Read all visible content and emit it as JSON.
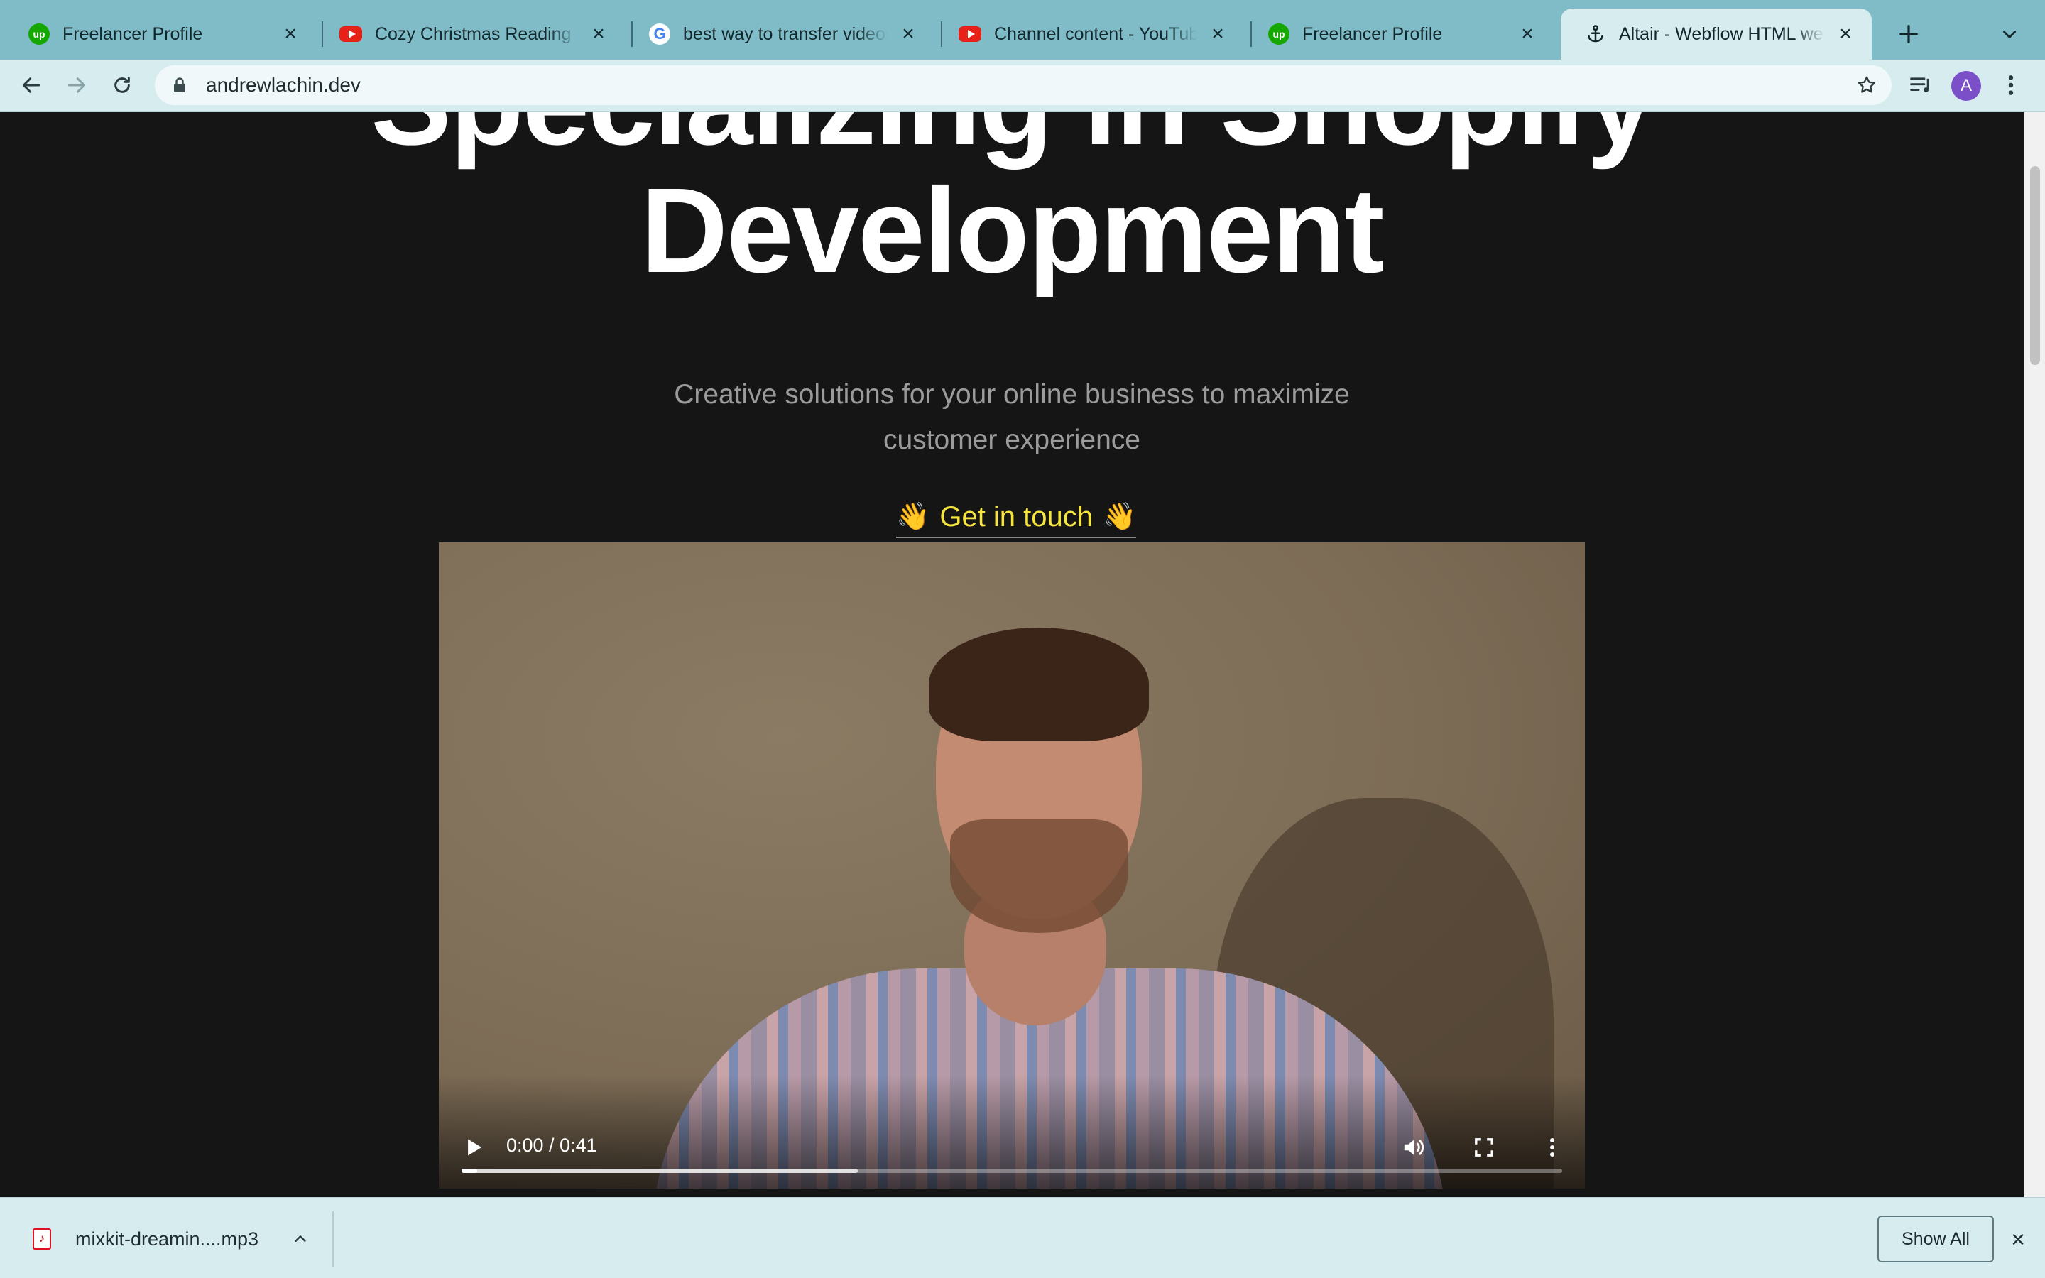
{
  "tabs": [
    {
      "title": "Freelancer Profile",
      "icon": "upwork-icon"
    },
    {
      "title": "Cozy Christmas Reading Nook",
      "icon": "youtube-icon"
    },
    {
      "title": "best way to transfer videos",
      "icon": "google-icon"
    },
    {
      "title": "Channel content - YouTube",
      "icon": "youtube-icon"
    },
    {
      "title": "Freelancer Profile",
      "icon": "upwork-icon"
    },
    {
      "title": "Altair - Webflow HTML website",
      "icon": "anchor-icon",
      "active": true
    }
  ],
  "toolbar": {
    "url": "andrewlachin.dev",
    "avatar_letter": "A"
  },
  "page": {
    "hero_line1": "Specializing in Shopify",
    "hero_line2": "Development",
    "subtitle": "Creative solutions for your online business to maximize customer experience",
    "cta_wave": "👋",
    "cta_label": "Get in touch",
    "video": {
      "time": "0:00 / 0:41",
      "progress": 0,
      "buffered": 0.36
    }
  },
  "download_shelf": {
    "file_name": "mixkit-dreamin....mp3",
    "show_all_label": "Show All"
  },
  "colors": {
    "tab_strip": "#7fbcc8",
    "toolbar": "#d6ecef",
    "page_bg": "#151515",
    "cta": "#f5e53c"
  }
}
